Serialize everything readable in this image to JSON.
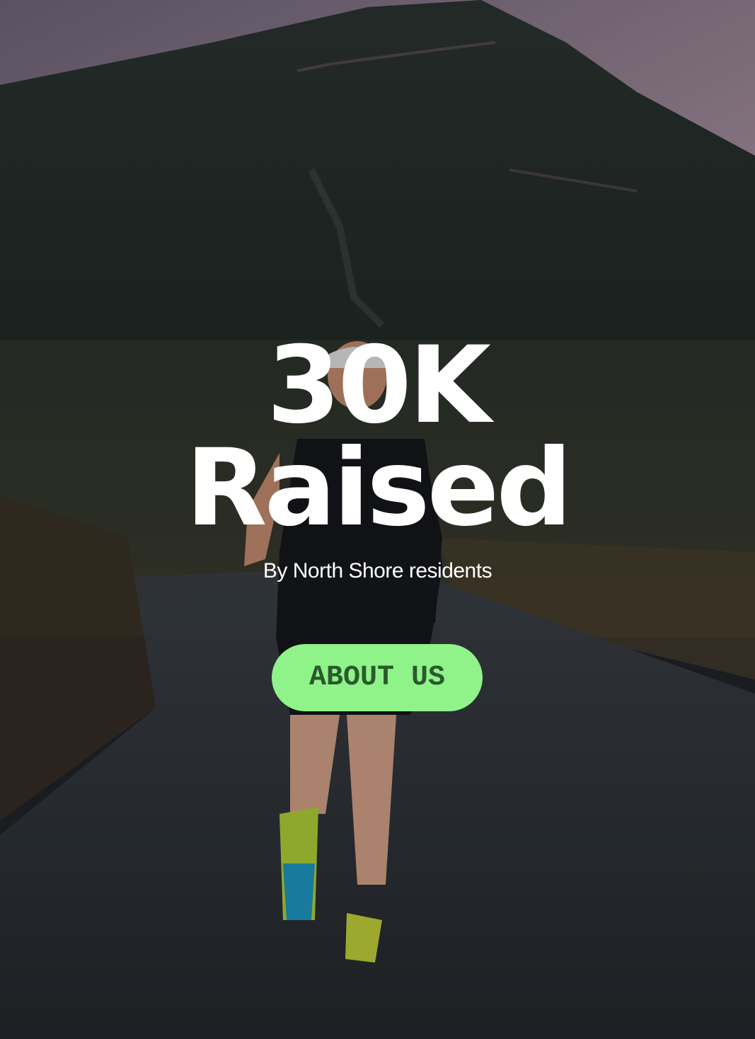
{
  "hero": {
    "headline_line1": "30K",
    "headline_line2": "Raised",
    "subtitle": "By North Shore residents",
    "cta_label": "ABOUT  US"
  },
  "colors": {
    "cta_background": "#8ff38a",
    "cta_text": "#2a5a2c",
    "headline": "#ffffff",
    "sky": "#9c8aa0",
    "mountain": "#2f3a34",
    "road": "#2e3236"
  }
}
